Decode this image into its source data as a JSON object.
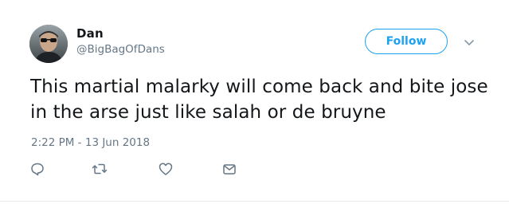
{
  "tweet": {
    "author": {
      "display_name": "Dan",
      "handle": "@BigBagOfDans"
    },
    "follow_label": "Follow",
    "text": "This martial malarky will come back and bite jose in the arse just like salah or de bruyne",
    "timestamp": "2:22 PM - 13 Jun 2018",
    "actions": {
      "reply_icon": "reply-icon",
      "retweet_icon": "retweet-icon",
      "like_icon": "heart-icon",
      "message_icon": "envelope-icon"
    }
  },
  "colors": {
    "accent": "#1da1f2",
    "text": "#14171a",
    "secondary": "#657786"
  }
}
